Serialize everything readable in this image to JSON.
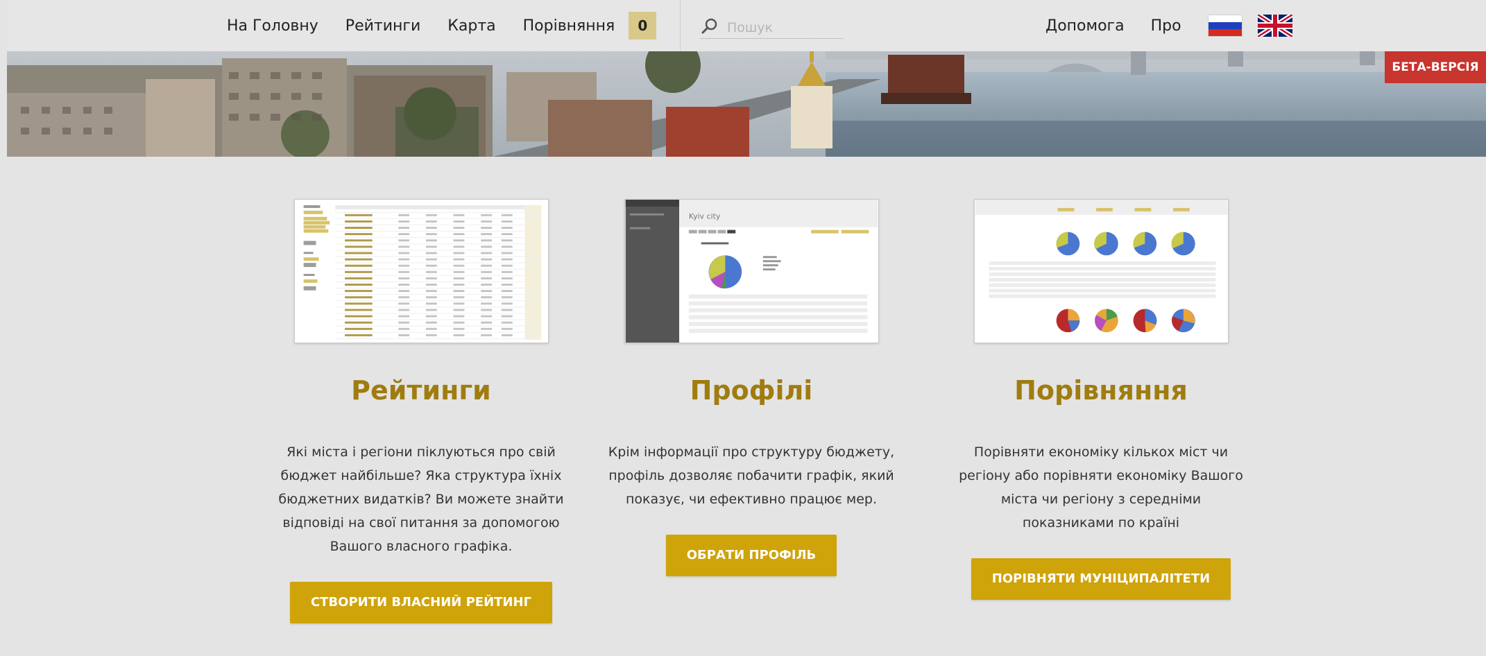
{
  "nav": {
    "home": "На Головну",
    "ratings": "Рейтинги",
    "map": "Карта",
    "compare": "Порівняння",
    "compare_count": "0",
    "search_placeholder": "Пошук",
    "help": "Допомога",
    "about": "Про"
  },
  "banner": {
    "beta_label": "БЕТА-ВЕРСІЯ"
  },
  "features": [
    {
      "title": "Рейтинги",
      "text": "Які міста і регіони піклуються про свій бюджет найбільше? Яка структура їхніх бюджетних видатків? Ви можете знайти відповіді на свої питання за допомогою Вашого власного графіка.",
      "button": "СТВОРИТИ ВЛАСНИЙ РЕЙТИНГ"
    },
    {
      "title": "Профілі",
      "text": "Крім інформації про структуру бюджету, профіль дозволяє побачити графік, який показує, чи ефективно працює мер.",
      "button": "ОБРАТИ ПРОФІЛЬ",
      "thumb_city": "Kyiv city"
    },
    {
      "title": "Порівняння",
      "text": "Порівняти економіку кількох міст чи регіону або порівняти економіку Вашого міста чи регіону з середніми показниками по країні",
      "button": "ПОРІВНЯТИ МУНІЦИПАЛІТЕТИ"
    }
  ],
  "colors": {
    "accent": "#cfa30a",
    "title": "#a07c10",
    "beta": "#c8342e",
    "page_bg": "#e4e4e4",
    "count_badge": "#d8c98a"
  },
  "icons": [
    "search-icon",
    "russian-flag-icon",
    "uk-flag-icon"
  ]
}
